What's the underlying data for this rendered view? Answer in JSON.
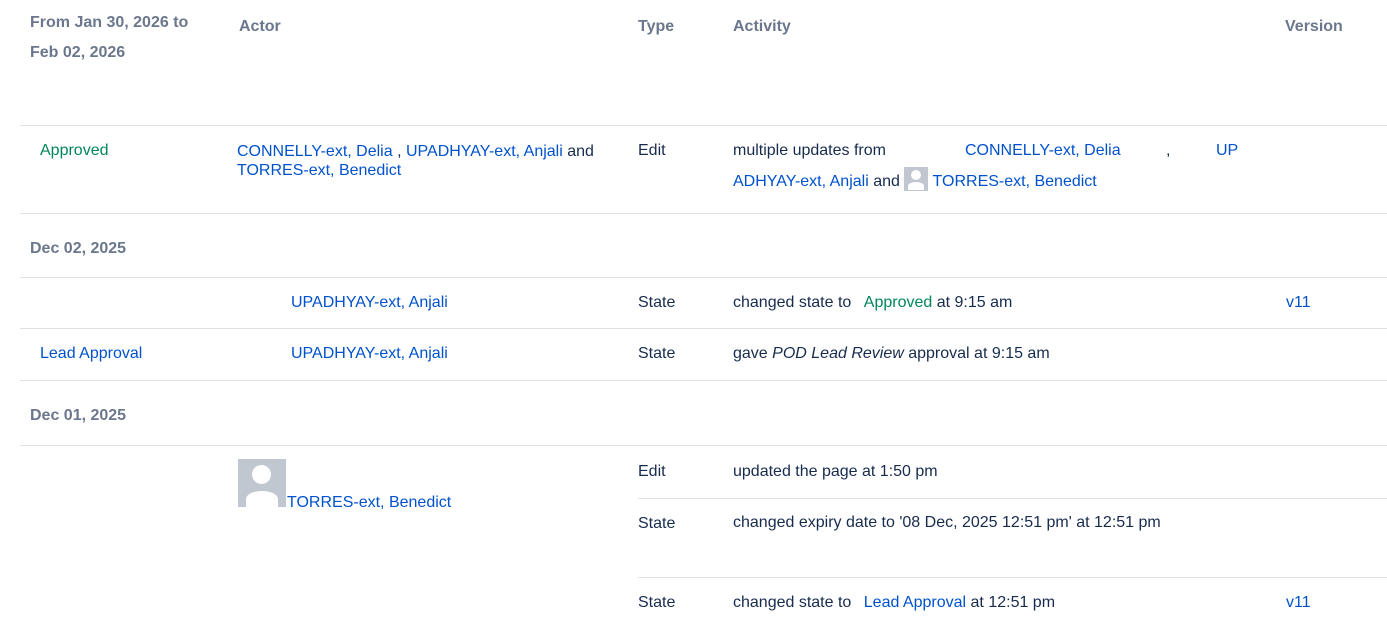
{
  "header": {
    "period": "From Jan 30, 2026 to Feb 02, 2026",
    "actor": "Actor",
    "type": "Type",
    "activity": "Activity",
    "version": "Version"
  },
  "row1": {
    "state_label": "Approved",
    "actor1": "CONNELLY-ext, Delia",
    "sep1": ",",
    "actor2": "UPADHYAY-ext, Anjali",
    "and": "and",
    "actor3": "TORRES-ext, Benedict",
    "type": "Edit",
    "activity_prefix": "multiple updates from",
    "act_actor1": "CONNELLY-ext, Delia",
    "act_sep": ",",
    "act_actor2": "UPADHYAY-ext, Anjali",
    "act_and": "and",
    "act_actor3": "TORRES-ext, Benedict"
  },
  "date1": "Dec 02, 2025",
  "row2": {
    "actor": "UPADHYAY-ext, Anjali",
    "type": "State",
    "activity_prefix": "changed state to",
    "state": "Approved",
    "activity_suffix": "at 9:15 am",
    "version": "v11"
  },
  "row3": {
    "state_label": "Lead Approval",
    "actor": "UPADHYAY-ext, Anjali",
    "type": "State",
    "activity_prefix": "gave",
    "activity_em": "POD Lead Review",
    "activity_suffix": "approval at 9:15 am"
  },
  "date2": "Dec 01, 2025",
  "row4": {
    "actor": "TORRES-ext, Benedict",
    "entries": [
      {
        "type": "Edit",
        "activity": "updated the page at 1:50 pm"
      },
      {
        "type": "State",
        "activity": "changed expiry date to '08 Dec, 2025 12:51 pm' at 12:51 pm"
      },
      {
        "type": "State",
        "activity_prefix": "changed state to",
        "state": "Lead Approval",
        "activity_suffix": "at 12:51 pm",
        "version": "v11"
      }
    ]
  }
}
